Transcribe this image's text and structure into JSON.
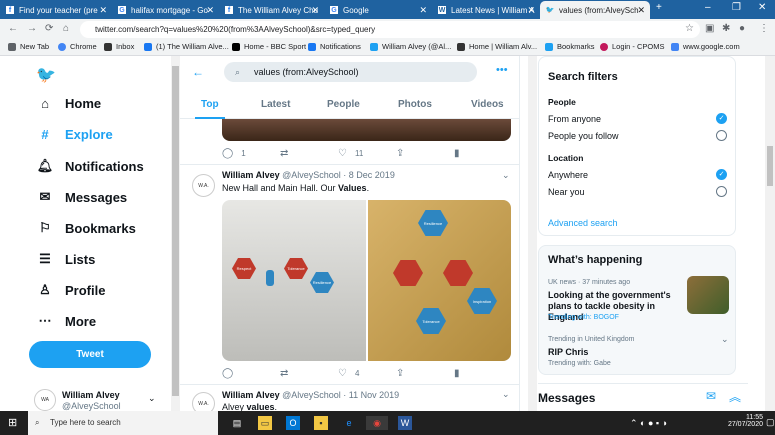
{
  "browser": {
    "tabs": [
      {
        "label": "Find your teacher (pre",
        "fav": "f"
      },
      {
        "label": "halifax mortgage - Go",
        "fav": "G"
      },
      {
        "label": "The William Alvey Chu",
        "fav": "f"
      },
      {
        "label": "Google",
        "fav": "G"
      },
      {
        "label": "Latest News | William A",
        "fav": "W"
      },
      {
        "label": "values (from:AlveySch",
        "fav": "t"
      }
    ],
    "url": "twitter.com/search?q=values%20%20(from%3AAlveySchool)&src=typed_query",
    "bookmarks": [
      "New Tab",
      "Chrome",
      "Inbox",
      "(1) The William Alve...",
      "Home - BBC Sport",
      "Notifications",
      "William Alvey (@Al...",
      "Home | William Alv...",
      "Bookmarks",
      "Login - CPOMS",
      "www.google.com"
    ]
  },
  "nav": {
    "items": [
      "Home",
      "Explore",
      "Notifications",
      "Messages",
      "Bookmarks",
      "Lists",
      "Profile",
      "More"
    ],
    "tweet_label": "Tweet",
    "user_name": "William Alvey",
    "user_handle": "@AlveySchool"
  },
  "search": {
    "query": "values  (from:AlveySchool)",
    "tabs": [
      "Top",
      "Latest",
      "People",
      "Photos",
      "Videos"
    ]
  },
  "tweets": [
    {
      "replies": "1",
      "retweets": "",
      "likes": "11"
    },
    {
      "name": "William Alvey",
      "meta": "@AlveySchool · 8 Dec 2019",
      "text_pre": "New Hall and Main Hall. Our ",
      "text_bold": "Values",
      "text_post": ".",
      "replies": "",
      "retweets": "",
      "likes": "4",
      "photo_labels": [
        "Respect",
        "Tolerance",
        "Resilience",
        "Resilience",
        "Tolerance",
        "Inspiration"
      ]
    },
    {
      "name": "William Alvey",
      "meta": "@AlveySchool · 11 Nov 2019",
      "text_pre": "Alvey ",
      "text_bold": "values",
      "text_post": "."
    }
  ],
  "filters": {
    "title": "Search filters",
    "people_label": "People",
    "from_anyone": "From anyone",
    "people_you_follow": "People you follow",
    "location_label": "Location",
    "anywhere": "Anywhere",
    "near_you": "Near you",
    "advanced": "Advanced search"
  },
  "happening": {
    "title": "What’s happening",
    "t1_meta": "UK news · 37 minutes ago",
    "t1_title": "Looking at the government's plans to tackle obesity in England",
    "t1_sub": "Trending with: BOGOF",
    "t2_meta": "Trending in United Kingdom",
    "t2_title": "RIP Chris",
    "t2_sub": "Trending with: Gabe"
  },
  "messages": {
    "title": "Messages"
  },
  "taskbar": {
    "search": "Type here to search",
    "time": "11:55",
    "date": "27/07/2020"
  },
  "colors": {
    "twitter_blue": "#1da1f2",
    "tab_bar": "#1f62a0"
  }
}
